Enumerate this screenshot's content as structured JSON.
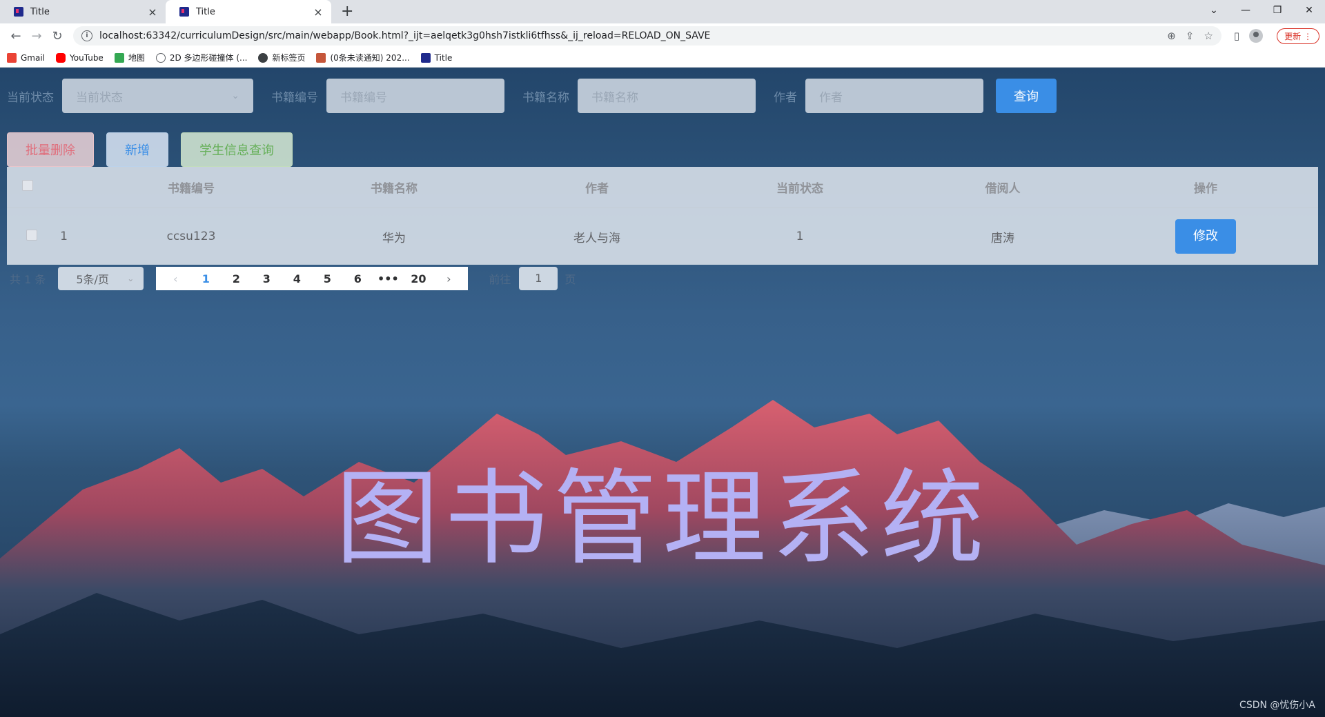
{
  "browser": {
    "tabs": [
      {
        "title": "Title",
        "active": false
      },
      {
        "title": "Title",
        "active": true
      }
    ],
    "new_tab": "+",
    "url": "localhost:63342/curriculumDesign/src/main/webapp/Book.html?_ijt=aelqetk3g0hsh7istkli6tfhss&_ij_reload=RELOAD_ON_SAVE",
    "update_label": "更新",
    "bookmarks": [
      {
        "label": "Gmail",
        "icon": "gmail-icon",
        "color": "#ea4335"
      },
      {
        "label": "YouTube",
        "icon": "youtube-icon",
        "color": "#ff0000"
      },
      {
        "label": "地图",
        "icon": "maps-icon",
        "color": "#34a853"
      },
      {
        "label": "2D 多边形碰撞体 (...",
        "icon": "globe-icon",
        "color": "#5f6368"
      },
      {
        "label": "新标签页",
        "icon": "chrome-icon",
        "color": "#3c4043"
      },
      {
        "label": "(0条未读通知) 202...",
        "icon": "csdn-icon",
        "color": "#c5563a"
      },
      {
        "label": "Title",
        "icon": "intellij-icon",
        "color": "#1f2a8c"
      }
    ]
  },
  "search": {
    "status_label": "当前状态",
    "status_placeholder": "当前状态",
    "book_id_label": "书籍编号",
    "book_id_placeholder": "书籍编号",
    "book_name_label": "书籍名称",
    "book_name_placeholder": "书籍名称",
    "author_label": "作者",
    "author_placeholder": "作者",
    "query_button": "查询"
  },
  "actions": {
    "batch_delete": "批量删除",
    "add": "新增",
    "student_query": "学生信息查询"
  },
  "table": {
    "headers": [
      "书籍编号",
      "书籍名称",
      "作者",
      "当前状态",
      "借阅人",
      "操作"
    ],
    "rows": [
      {
        "index": "1",
        "book_id": "ccsu123",
        "book_name": "华为",
        "author": "老人与海",
        "status": "1",
        "borrower": "唐涛",
        "action": "修改"
      }
    ]
  },
  "pagination": {
    "total": "共 1 条",
    "page_size": "5条/页",
    "pages": [
      "1",
      "2",
      "3",
      "4",
      "5",
      "6",
      "•••",
      "20"
    ],
    "current": "1",
    "goto_label": "前往",
    "goto_value": "1",
    "goto_unit": "页"
  },
  "banner_title": "图书管理系统",
  "watermark": "CSDN @忧伤小A",
  "colors": {
    "primary": "#3a8ee6",
    "danger": "#e06f7d",
    "success": "#67b05a",
    "title": "#b4b1f4"
  }
}
